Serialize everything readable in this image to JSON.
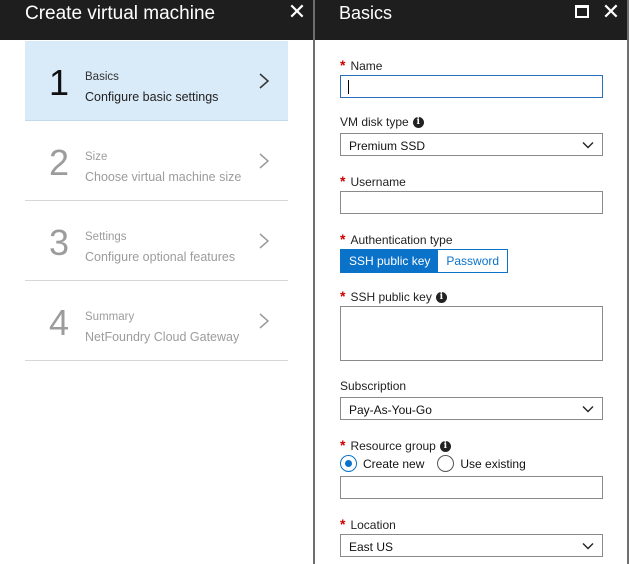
{
  "left_blade": {
    "title": "Create virtual machine",
    "steps": [
      {
        "number": "1",
        "title": "Basics",
        "subtitle": "Configure basic settings",
        "active": true
      },
      {
        "number": "2",
        "title": "Size",
        "subtitle": "Choose virtual machine size",
        "active": false
      },
      {
        "number": "3",
        "title": "Settings",
        "subtitle": "Configure optional features",
        "active": false
      },
      {
        "number": "4",
        "title": "Summary",
        "subtitle": "NetFoundry Cloud Gateway",
        "active": false
      }
    ]
  },
  "right_blade": {
    "title": "Basics",
    "required_mark": "*",
    "info_glyph": "i",
    "fields": {
      "name": {
        "label": "Name",
        "value": ""
      },
      "vm_disk_type": {
        "label": "VM disk type",
        "value": "Premium SSD"
      },
      "username": {
        "label": "Username",
        "value": ""
      },
      "auth_type": {
        "label": "Authentication type",
        "options": [
          "SSH public key",
          "Password"
        ],
        "selected": "SSH public key"
      },
      "ssh_key": {
        "label": "SSH public key",
        "value": ""
      },
      "subscription": {
        "label": "Subscription",
        "value": "Pay-As-You-Go"
      },
      "resource_group": {
        "label": "Resource group",
        "options": [
          "Create new",
          "Use existing"
        ],
        "selected": "Create new",
        "value": ""
      },
      "location": {
        "label": "Location",
        "value": "East US"
      }
    }
  },
  "colors": {
    "titlebar": "#1e1e1e",
    "active_step": "#d9ebf9",
    "accent": "#0a72c9",
    "required": "#cc0000"
  },
  "icons": {
    "close": "close-icon",
    "maximize": "maximize-icon",
    "chevron": "chevron-right-icon",
    "dropdown": "chevron-down-icon",
    "info": "info-icon"
  }
}
